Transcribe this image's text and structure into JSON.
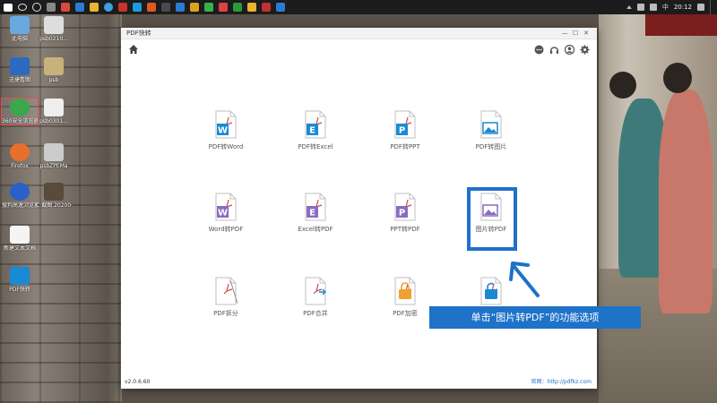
{
  "window": {
    "title": "PDF快转",
    "version": "v2.0.6.60",
    "website": "官网：http://pdfkz.com"
  },
  "tools": [
    {
      "label": "PDF转Word",
      "badge": "W",
      "color": "#1a8ad4"
    },
    {
      "label": "PDF转Excel",
      "badge": "E",
      "color": "#1a8ad4"
    },
    {
      "label": "PDF转PPT",
      "badge": "P",
      "color": "#1a8ad4"
    },
    {
      "label": "PDF转图片",
      "badge": "",
      "color": "#1a8ad4"
    },
    {
      "label": "Word转PDF",
      "badge": "W",
      "color": "#8a6cc0"
    },
    {
      "label": "Excel转PDF",
      "badge": "E",
      "color": "#8a6cc0"
    },
    {
      "label": "PPT转PDF",
      "badge": "P",
      "color": "#8a6cc0"
    },
    {
      "label": "图片转PDF",
      "badge": "",
      "color": "#8a6cc0"
    },
    {
      "label": "PDF拆分",
      "badge": "",
      "color": "#9a9a9a"
    },
    {
      "label": "PDF合并",
      "badge": "",
      "color": "#1a8ad4"
    },
    {
      "label": "PDF加密",
      "badge": "",
      "color": "#f0a030"
    },
    {
      "label": "PDF解密",
      "badge": "",
      "color": "#1a8ad4"
    }
  ],
  "caption": "单击“图片转PDF”的功能选项",
  "taskbar": {
    "clock": "20:12",
    "ime": "中"
  },
  "desktop_icons": [
    {
      "label": "此电脑"
    },
    {
      "label": "psb0210..."
    },
    {
      "label": "迅捷看图"
    },
    {
      "label": "psb"
    },
    {
      "label": "360安全浏览器"
    },
    {
      "label": "psb0301..."
    },
    {
      "label": "Firefox"
    },
    {
      "label": "psbZPEMa"
    },
    {
      "label": "搜狗高速浏览器"
    },
    {
      "label": "C:截图 2020060..."
    },
    {
      "label": "新建文本文档"
    },
    {
      "label": "PDF快转"
    }
  ],
  "colors": {
    "accent": "#1e72c8",
    "highlight": "#1e72c8"
  }
}
